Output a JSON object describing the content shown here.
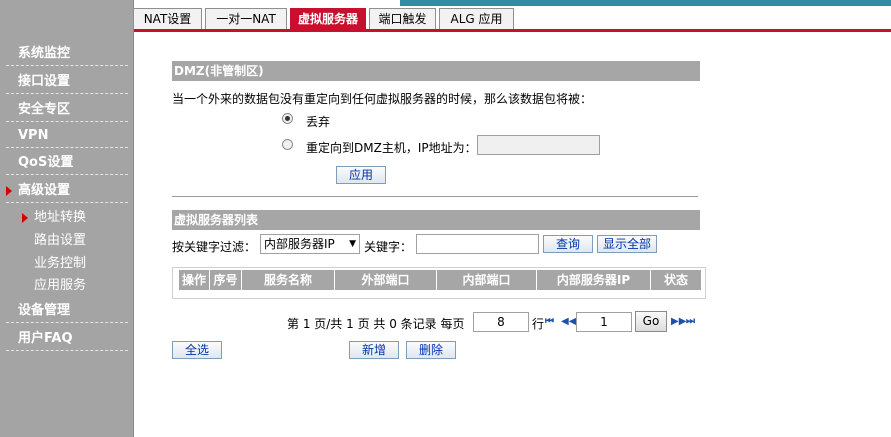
{
  "tabs": [
    {
      "label": "NAT设置"
    },
    {
      "label": "一对一NAT"
    },
    {
      "label": "虚拟服务器"
    },
    {
      "label": "端口触发"
    },
    {
      "label": "ALG 应用"
    }
  ],
  "sidebar": {
    "items": [
      {
        "label": "系统监控"
      },
      {
        "label": "接口设置"
      },
      {
        "label": "安全专区"
      },
      {
        "label": "VPN"
      },
      {
        "label": "QoS设置"
      },
      {
        "label": "高级设置"
      },
      {
        "label": "设备管理"
      },
      {
        "label": "用户FAQ"
      }
    ],
    "subitems": [
      {
        "label": "地址转换"
      },
      {
        "label": "路由设置"
      },
      {
        "label": "业务控制"
      },
      {
        "label": "应用服务"
      }
    ]
  },
  "dmz": {
    "title": "DMZ(非管制区)",
    "description": "当一个外来的数据包没有重定向到任何虚拟服务器的时候，那么该数据包将被：",
    "option_discard": "丢弃",
    "option_redirect": "重定向到DMZ主机，IP地址为：",
    "ip_value": "",
    "apply_label": "应用"
  },
  "vs_list": {
    "title": "虚拟服务器列表",
    "filter_label": "按关键字过滤：",
    "filter_select": "内部服务器IP",
    "keyword_label": "关键字：",
    "keyword_value": "",
    "query_label": "查询",
    "show_all_label": "显示全部",
    "columns": [
      "操作",
      "序号",
      "服务名称",
      "外部端口",
      "内部端口",
      "内部服务器IP",
      "状态"
    ],
    "rows": []
  },
  "pagination": {
    "summary": "第 1 页/共 1 页 共 0 条记录 每页",
    "per_page": "8",
    "rows_label": "行",
    "page": "1",
    "go_label": "Go"
  },
  "actions": {
    "select_all": "全选",
    "add": "新增",
    "delete": "删除"
  }
}
